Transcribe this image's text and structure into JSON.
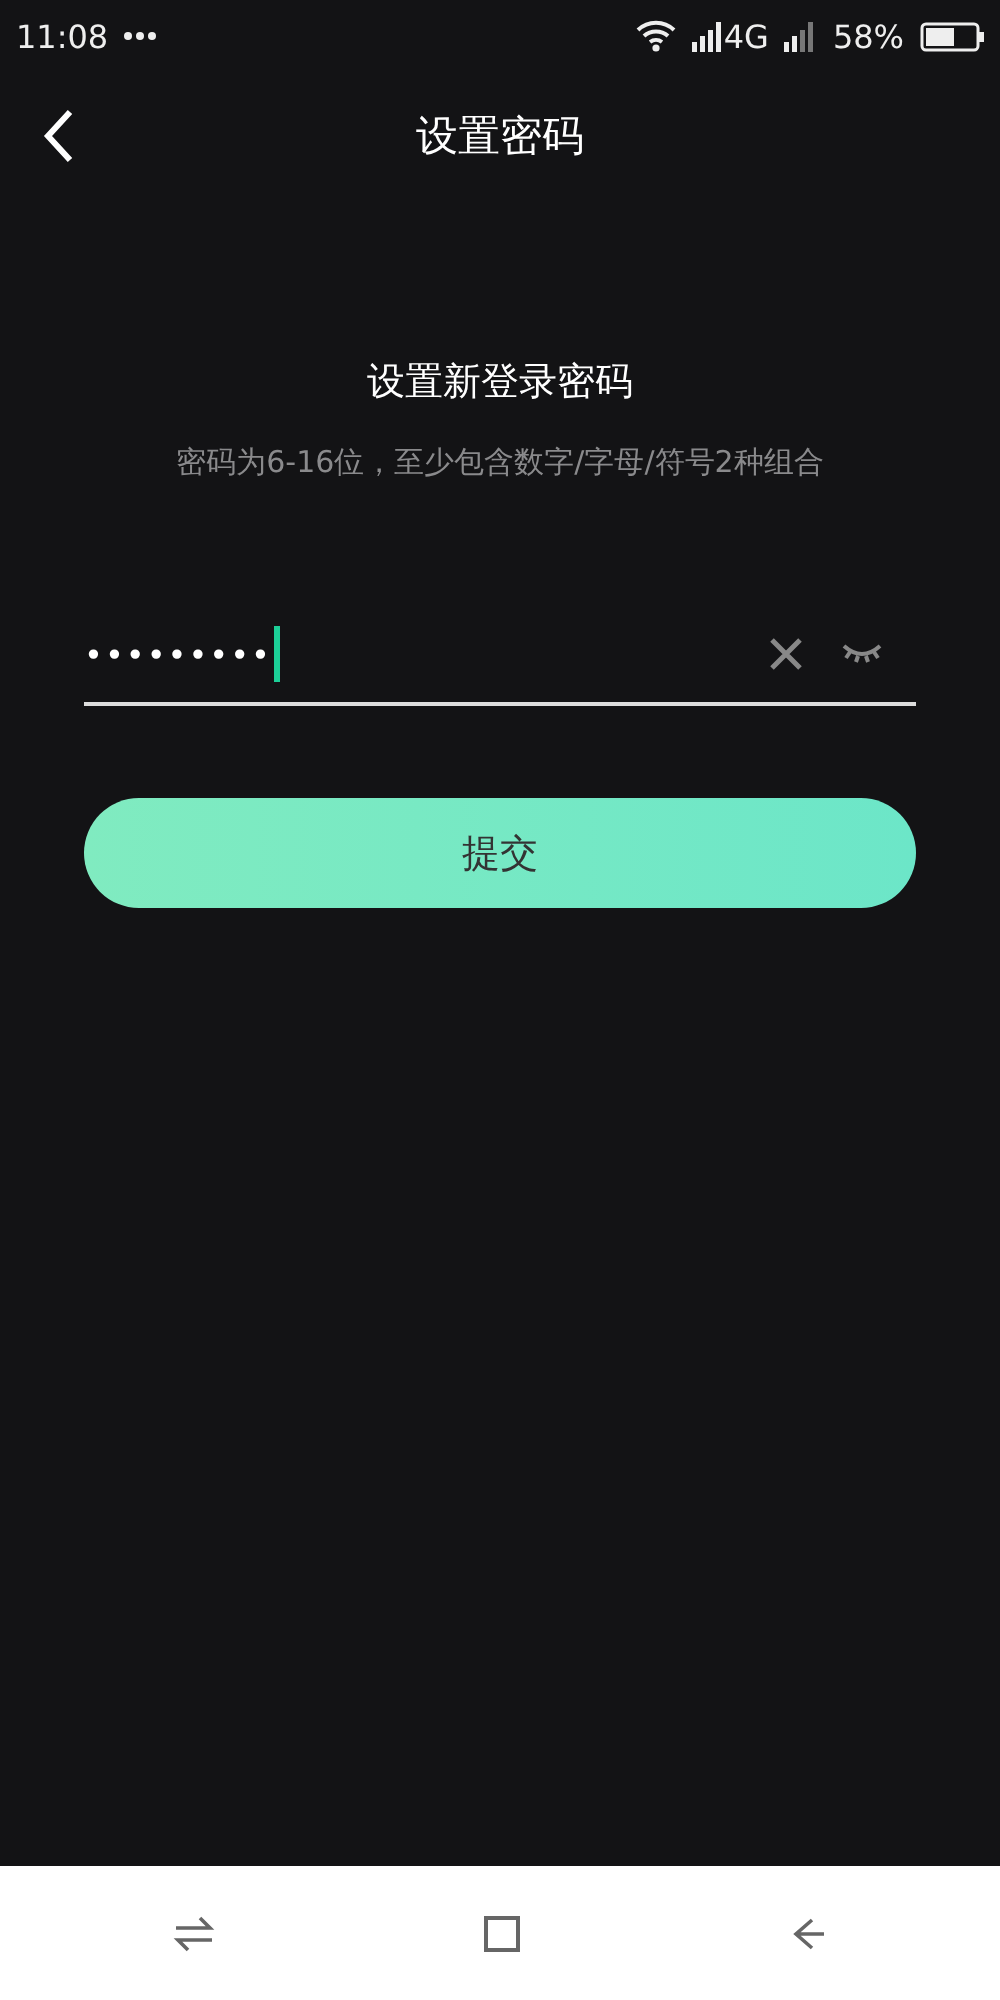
{
  "status_bar": {
    "time": "11:08",
    "network": "4G",
    "battery": "58%"
  },
  "header": {
    "title": "设置密码"
  },
  "heading": "设置新登录密码",
  "hint": "密码为6-16位，至少包含数字/字母/符号2种组合",
  "password_field": {
    "value": "•••••••••",
    "focused": true,
    "visible": false
  },
  "submit_button": "提交"
}
